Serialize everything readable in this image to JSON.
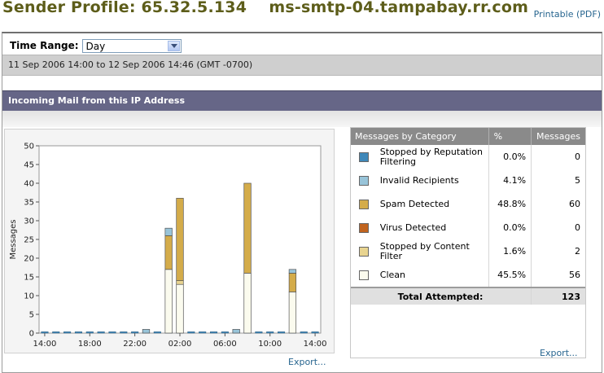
{
  "header": {
    "title": "Sender Profile: 65.32.5.134    ms-smtp-04.tampabay.rr.com",
    "printable_link": "Printable (PDF)"
  },
  "time_range": {
    "label": "Time Range:",
    "selected": "Day",
    "range_text": "11 Sep 2006 14:00 to 12 Sep 2006 14:46 (GMT -0700)"
  },
  "section": {
    "title": "Incoming Mail from this IP Address"
  },
  "chart_export_link": "Export...",
  "table_export_link": "Export...",
  "legend": {
    "headers": [
      "Messages by Category",
      "%",
      "Messages"
    ],
    "rows": [
      {
        "label": "Stopped by Reputation Filtering",
        "pct": "0.0%",
        "count": "0",
        "color": "#3f88b9"
      },
      {
        "label": "Invalid Recipients",
        "pct": "4.1%",
        "count": "5",
        "color": "#98c4d9"
      },
      {
        "label": "Spam Detected",
        "pct": "48.8%",
        "count": "60",
        "color": "#d4ac4a"
      },
      {
        "label": "Virus Detected",
        "pct": "0.0%",
        "count": "0",
        "color": "#c1641f"
      },
      {
        "label": "Stopped by Content Filter",
        "pct": "1.6%",
        "count": "2",
        "color": "#e8d490"
      },
      {
        "label": "Clean",
        "pct": "45.5%",
        "count": "56",
        "color": "#fbfbee"
      }
    ],
    "total_label": "Total Attempted:",
    "total_value": "123"
  },
  "chart_data": {
    "type": "bar",
    "stacked": true,
    "ylabel": "Messages",
    "xlabel": "",
    "ylim": [
      0,
      50
    ],
    "yticks": [
      0,
      5,
      10,
      15,
      20,
      25,
      30,
      35,
      40,
      45,
      50
    ],
    "xtick_labels": [
      "14:00",
      "18:00",
      "22:00",
      "02:00",
      "06:00",
      "10:00",
      "14:00"
    ],
    "categories": [
      "14:00",
      "15:00",
      "16:00",
      "17:00",
      "18:00",
      "19:00",
      "20:00",
      "21:00",
      "22:00",
      "23:00",
      "00:00",
      "01:00",
      "02:00",
      "03:00",
      "04:00",
      "05:00",
      "06:00",
      "07:00",
      "08:00",
      "09:00",
      "10:00",
      "11:00",
      "12:00",
      "13:00",
      "14:00"
    ],
    "series": [
      {
        "name": "Clean",
        "color": "#fbfbee",
        "values": [
          0,
          0,
          0,
          0,
          0,
          0,
          0,
          0,
          0,
          0,
          0,
          17,
          13,
          0,
          0,
          0,
          0,
          0,
          16,
          0,
          0,
          0,
          11,
          0,
          0
        ]
      },
      {
        "name": "Stopped by Content Filter",
        "color": "#e8d490",
        "values": [
          0,
          0,
          0,
          0,
          0,
          0,
          0,
          0,
          0,
          0,
          0,
          0,
          1,
          0,
          0,
          0,
          0,
          0,
          0,
          0,
          0,
          0,
          0,
          0,
          0
        ]
      },
      {
        "name": "Spam Detected",
        "color": "#d4ac4a",
        "values": [
          0,
          0,
          0,
          0,
          0,
          0,
          0,
          0,
          0,
          0,
          0,
          9,
          22,
          0,
          0,
          0,
          0,
          0,
          24,
          0,
          0,
          0,
          5,
          0,
          0
        ]
      },
      {
        "name": "Invalid Recipients",
        "color": "#98c4d9",
        "values": [
          0,
          0,
          0,
          0,
          0,
          0,
          0,
          0,
          0,
          1,
          0,
          2,
          0,
          0,
          0,
          0,
          0,
          1,
          0,
          0,
          0,
          0,
          1,
          0,
          0
        ]
      },
      {
        "name": "Stopped by Reputation Filtering",
        "color": "#3f88b9",
        "values": [
          0,
          0,
          0,
          0,
          0,
          0,
          0,
          0,
          0,
          0,
          0,
          0,
          0,
          0,
          0,
          0,
          0,
          0,
          0,
          0,
          0,
          0,
          0,
          0,
          0
        ]
      },
      {
        "name": "Virus Detected",
        "color": "#c1641f",
        "values": [
          0,
          0,
          0,
          0,
          0,
          0,
          0,
          0,
          0,
          0,
          0,
          0,
          0,
          0,
          0,
          0,
          0,
          0,
          0,
          0,
          0,
          0,
          0,
          0,
          0
        ]
      }
    ],
    "grid": false,
    "legend": "none"
  }
}
